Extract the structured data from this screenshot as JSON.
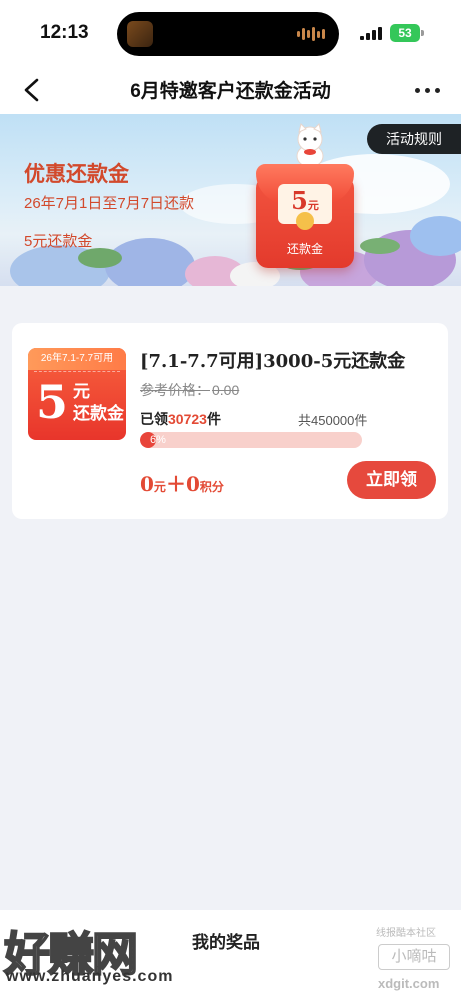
{
  "status_bar": {
    "time": "12:13",
    "battery": "53"
  },
  "nav": {
    "title": "6月特邀客户还款金活动",
    "back_icon": "chevron-left-icon",
    "more_icon": "more-dots-icon"
  },
  "banner": {
    "title": "优惠还款金",
    "date_range": "26年7月1日至7月7日还款",
    "amount_text": "5元还款金",
    "rules_button": "活动规则",
    "packet_amount": "5",
    "packet_unit": "元",
    "packet_label": "还款金"
  },
  "coupon": {
    "badge_validity": "26年7.1-7.7可用",
    "badge_amount": "5",
    "badge_unit": "元",
    "badge_name": "还款金",
    "title": "[7.1-7.7可用]3000-5元还款金",
    "ref_price_label": "参考价格：",
    "ref_price_value": "0.00",
    "claimed_prefix": "已领",
    "claimed_count": "30723",
    "claimed_suffix": "件",
    "total_text": "共450000件",
    "progress_percent": 6,
    "progress_label": "6%",
    "price_cash": "0",
    "price_cash_unit": "元",
    "price_plus": "＋",
    "price_points": "0",
    "price_points_unit": "积分",
    "claim_button": "立即领",
    "accent_color": "#e6493d"
  },
  "bottom_bar": {
    "my_prizes": "我的奖品"
  },
  "watermarks": {
    "left_brand": "好赚网",
    "left_url": "www.zhuanyes.com",
    "right_small": "线报酷本社区",
    "right_brand": "小嘀咕",
    "right_url": "xdgit.com"
  }
}
